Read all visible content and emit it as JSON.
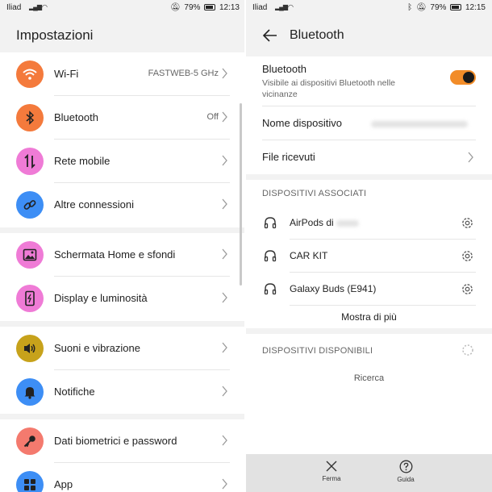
{
  "left": {
    "statusbar": {
      "carrier": "Iliad",
      "battery": "79%",
      "time": "12:13"
    },
    "title": "Impostazioni",
    "groups": [
      [
        {
          "label": "Wi-Fi",
          "value": "FASTWEB-5 GHz",
          "icon": "wifi-icon",
          "color": "#f47a3c"
        },
        {
          "label": "Bluetooth",
          "value": "Off",
          "icon": "bluetooth-icon",
          "color": "#f47a3c"
        },
        {
          "label": "Rete mobile",
          "value": "",
          "icon": "mobile-data-icon",
          "color": "#ef7bd6"
        },
        {
          "label": "Altre connessioni",
          "value": "",
          "icon": "link-icon",
          "color": "#3d8ef5"
        }
      ],
      [
        {
          "label": "Schermata Home e sfondi",
          "value": "",
          "icon": "image-icon",
          "color": "#ef7bd6"
        },
        {
          "label": "Display e luminosità",
          "value": "",
          "icon": "phone-brightness-icon",
          "color": "#ef7bd6"
        }
      ],
      [
        {
          "label": "Suoni e vibrazione",
          "value": "",
          "icon": "speaker-icon",
          "color": "#c7a21b"
        },
        {
          "label": "Notifiche",
          "value": "",
          "icon": "bell-icon",
          "color": "#3d8ef5"
        }
      ],
      [
        {
          "label": "Dati biometrici e password",
          "value": "",
          "icon": "key-icon",
          "color": "#f47a6e"
        },
        {
          "label": "App",
          "value": "",
          "icon": "apps-grid-icon",
          "color": "#3d8ef5"
        }
      ]
    ]
  },
  "right": {
    "statusbar": {
      "carrier": "Iliad",
      "battery": "79%",
      "time": "12:15"
    },
    "title": "Bluetooth",
    "bluetooth": {
      "label": "Bluetooth",
      "sub": "Visibile ai dispositivi Bluetooth nelle vicinanze",
      "enabled": true
    },
    "device_name_label": "Nome dispositivo",
    "received_files_label": "File ricevuti",
    "paired_header": "DISPOSITIVI ASSOCIATI",
    "paired": [
      {
        "name": "AirPods di"
      },
      {
        "name": "CAR KIT"
      },
      {
        "name": "Galaxy Buds (E941)"
      }
    ],
    "show_more": "Mostra di più",
    "available_header": "DISPOSITIVI DISPONIBILI",
    "searching": "Ricerca",
    "bottom": {
      "stop": "Ferma",
      "help": "Guida"
    },
    "accent": "#f28c28"
  }
}
